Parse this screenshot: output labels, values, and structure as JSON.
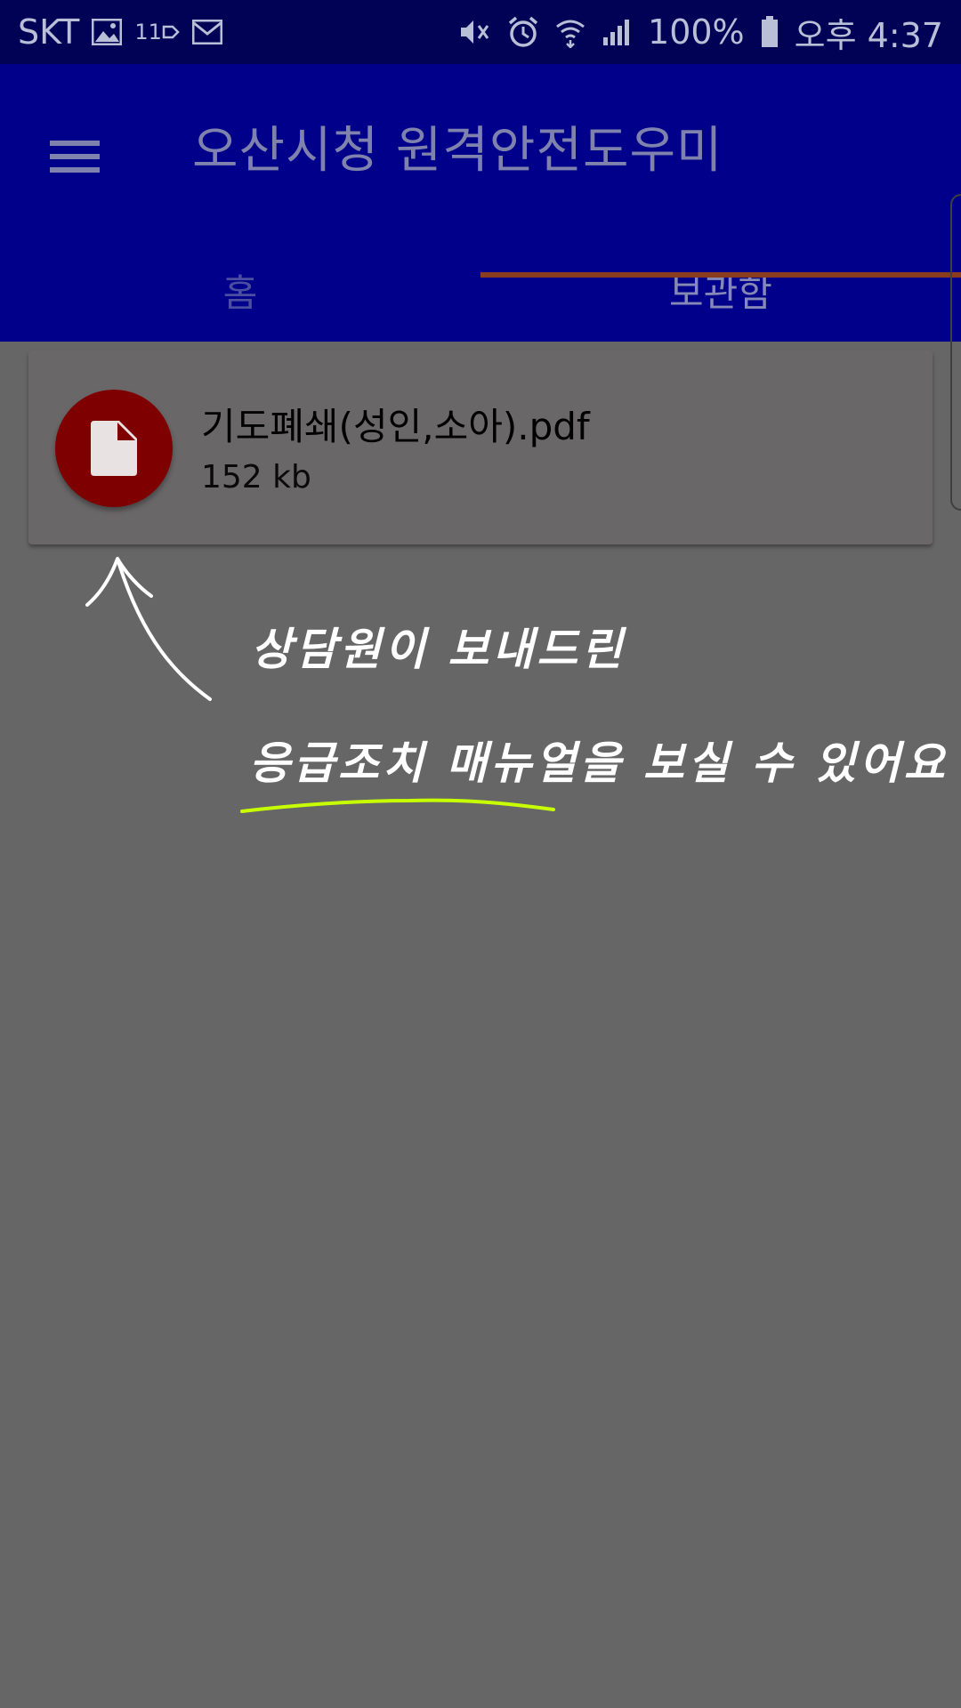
{
  "status_bar": {
    "carrier": "SKT",
    "eleven_label": "11",
    "battery": "100%",
    "time": "오후 4:37",
    "icons": [
      "image-icon",
      "mail-icon",
      "mute-vibrate-icon",
      "alarm-icon",
      "wifi-icon",
      "signal-icon",
      "battery-icon"
    ]
  },
  "app_bar": {
    "title": "오산시청 원격안전도우미",
    "menu_icon": "hamburger-menu-icon"
  },
  "tabs": [
    {
      "label": "홈",
      "active": false
    },
    {
      "label": "보관함",
      "active": true
    }
  ],
  "files": [
    {
      "name": "기도폐쇄(성인,소아).pdf",
      "size": "152 kb",
      "icon": "pdf-document-icon",
      "icon_color": "#7f0000"
    }
  ],
  "annotation": {
    "line1": "상담원이 보내드린",
    "line2": "응급조치 매뉴얼을 보실 수 있어요",
    "underline_color": "#c8ff00",
    "text_color": "#ffffff"
  },
  "colors": {
    "status_bar": "#010155",
    "app_bar": "#00008a",
    "tab_indicator": "#8a3c1e",
    "background": "#666666"
  }
}
